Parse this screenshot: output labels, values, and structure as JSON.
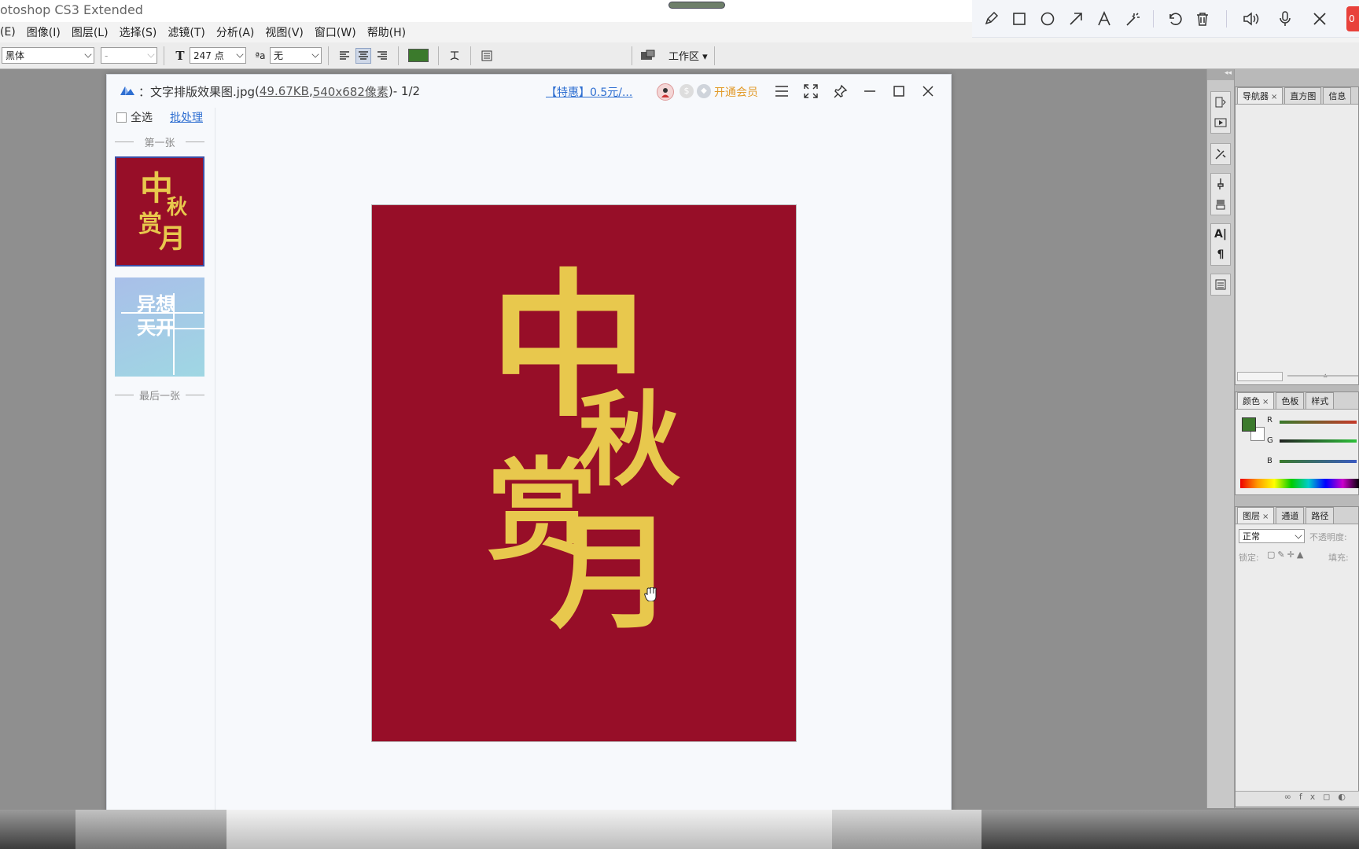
{
  "ps": {
    "title": "otoshop CS3 Extended",
    "menu": [
      "(E)",
      "图像(I)",
      "图层(L)",
      "选择(S)",
      "滤镜(T)",
      "分析(A)",
      "视图(V)",
      "窗口(W)",
      "帮助(H)"
    ],
    "options": {
      "font_family": "黑体",
      "font_style": "-",
      "font_size": "247 点",
      "antialias_icon": "ªa",
      "antialias": "无",
      "workspace": "工作区 ▾"
    },
    "color_accent": "#3b7a2c"
  },
  "annotation_toolbar": {
    "icons": [
      "pencil-icon",
      "rectangle-icon",
      "circle-icon",
      "arrow-icon",
      "text-icon",
      "magic-wand-icon",
      "undo-icon",
      "trash-icon",
      "speaker-icon",
      "microphone-icon",
      "close-icon"
    ],
    "record_badge": "0"
  },
  "viewer": {
    "filename": "文字排版效果图.jpg",
    "title_prefix": "：",
    "paren_open": " (",
    "filesize": "49.67KB",
    "comma": " , ",
    "dimensions": "540x682像素",
    "paren_close": ")",
    "page": " - 1/2",
    "promo": "【特惠】0.5元/...",
    "vip": "开通会员",
    "select_all": "全选",
    "batch": "批处理",
    "first_label": "第一张",
    "last_label": "最后一张",
    "thumb2_text": [
      "异想",
      "天开"
    ],
    "image_text": [
      "中",
      "秋",
      "赏",
      "月"
    ],
    "image_bg": "#970e28",
    "image_text_color": "#e8c84d"
  },
  "panels": {
    "navigator_tabs": [
      "导航器",
      "直方图",
      "信息"
    ],
    "color_tabs": [
      "颜色",
      "色板",
      "样式"
    ],
    "channels": [
      "R",
      "G",
      "B"
    ],
    "layers_tabs": [
      "图层",
      "通道",
      "路径"
    ],
    "blend_mode": "正常",
    "opacity_label": "不透明度:",
    "lock_label": "锁定:",
    "fill_label": "填充:"
  }
}
